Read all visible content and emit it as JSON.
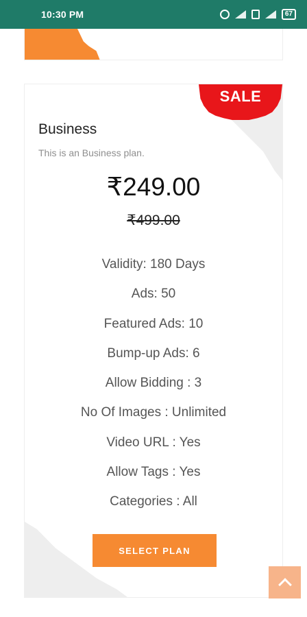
{
  "status_bar": {
    "time": "10:30 PM",
    "battery": "67"
  },
  "plan": {
    "badge": "SALE",
    "name": "Business",
    "description": "This is an Business plan.",
    "price": "₹249.00",
    "old_price": "₹499.00",
    "features": [
      "Validity: 180 Days",
      "Ads: 50",
      "Featured Ads: 10",
      "Bump-up Ads: 6",
      "Allow Bidding : 3",
      "No Of Images : Unlimited",
      "Video URL : Yes",
      "Allow Tags : Yes",
      "Categories : All"
    ],
    "button_label": "SELECT PLAN"
  },
  "colors": {
    "status_bar": "#1f7b68",
    "accent": "#f68a32",
    "sale": "#e8161a",
    "scroll_top": "#f7b48a"
  }
}
